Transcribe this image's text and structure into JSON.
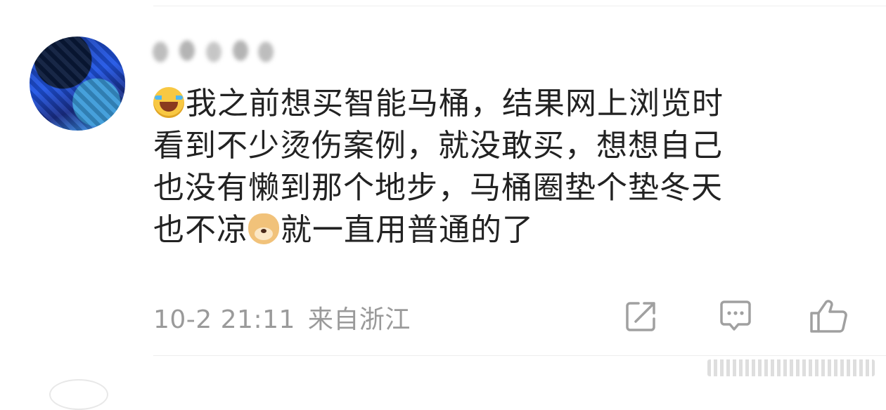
{
  "comment": {
    "username": "",
    "text_line1": "我之前想买智能马桶，结果网上浏览时",
    "text_line2": "看到不少烫伤案例，就没敢买，想想自己",
    "text_line3": "也没有懒到那个地步，马桶圈垫个垫冬天",
    "text_line4a": "也不凉",
    "text_line4b": "就一直用普通的了",
    "timestamp": "10-2 21:11",
    "location": "来自浙江"
  },
  "icons": {
    "leading_emoji": "laughing-tears-emoji",
    "inline_emoji": "doge-emoji",
    "actions": [
      "share-icon",
      "comment-icon",
      "like-icon"
    ]
  },
  "colors": {
    "text": "#222222",
    "meta": "#9a9a9a",
    "icon": "#a0a0a0",
    "avatar_blue": "#1f55e6"
  }
}
